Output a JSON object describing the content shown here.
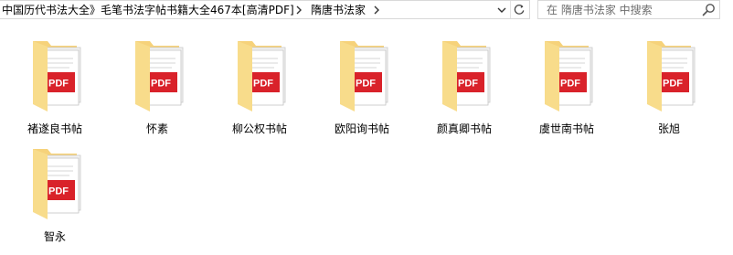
{
  "window": {
    "breadcrumb": [
      {
        "label": "中国历代书法大全》毛笔书法字帖书籍大全467本[高清PDF]"
      },
      {
        "label": "隋唐书法家"
      }
    ],
    "search": {
      "placeholder": "在 隋唐书法家 中搜索"
    }
  },
  "folder_icon": {
    "folder_color": "#f6d27a",
    "folder_front_color": "#f8dc8b",
    "pdf_badge_color": "#d9222a",
    "pdf_badge_text": "PDF"
  },
  "folders": [
    {
      "label": "褚遂良书帖"
    },
    {
      "label": "怀素"
    },
    {
      "label": "柳公权书帖"
    },
    {
      "label": "欧阳询书帖"
    },
    {
      "label": "颜真卿书帖"
    },
    {
      "label": "虞世南书帖"
    },
    {
      "label": "张旭"
    },
    {
      "label": "智永"
    }
  ]
}
